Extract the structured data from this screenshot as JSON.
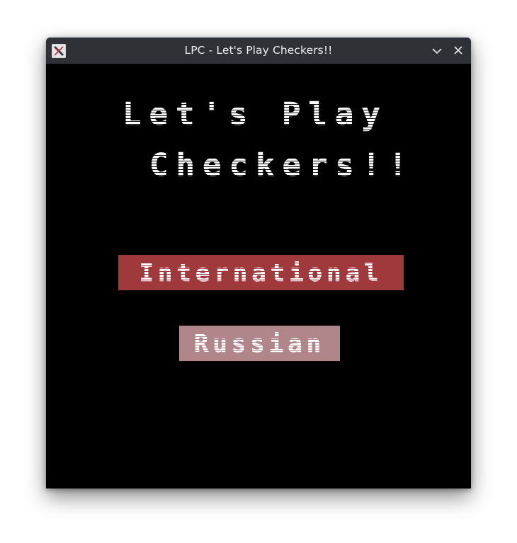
{
  "window": {
    "title": "LPC - Let's Play Checkers!!",
    "app_icon": "x-app-icon",
    "controls": {
      "minimize_icon": "chevron-down-icon",
      "close_icon": "close-icon"
    }
  },
  "game": {
    "heading_line1": "Let's Play",
    "heading_line2": "Checkers!!",
    "menu": [
      {
        "label": "International",
        "color": "#a0393c"
      },
      {
        "label": "Russian",
        "color": "#b0868a"
      }
    ]
  },
  "colors": {
    "titlebar": "#2e3136",
    "background": "#000000",
    "text": "#ffffff"
  }
}
